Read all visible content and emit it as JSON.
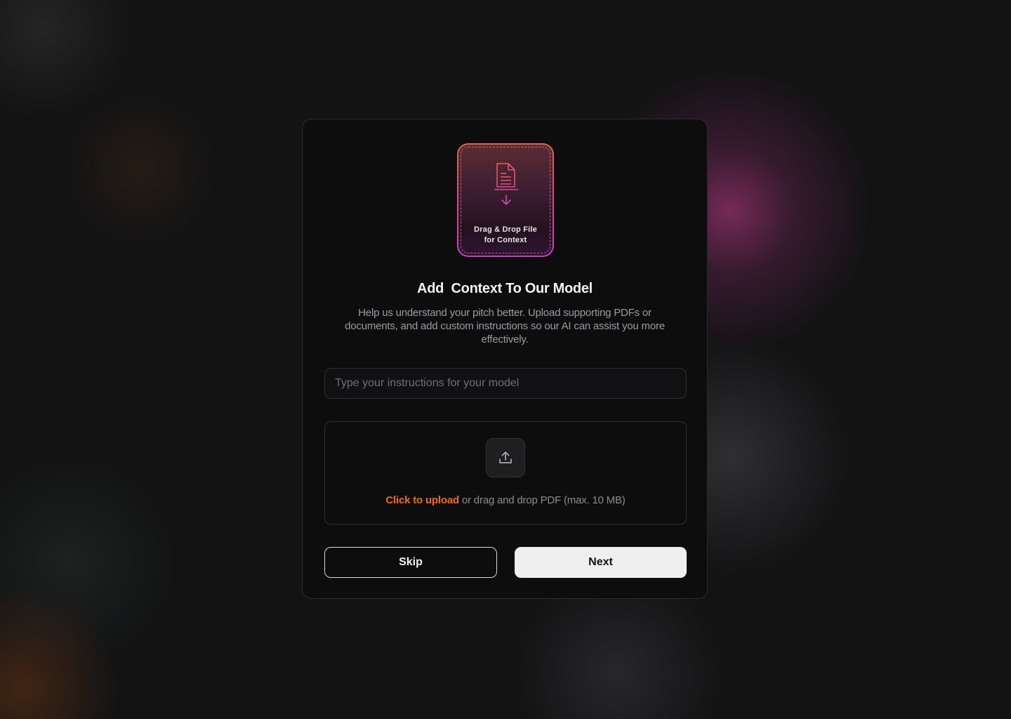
{
  "drop_tile": {
    "line1": "Drag & Drop File",
    "line2": "for Context",
    "icon": "document-download-icon"
  },
  "header": {
    "title": "Add  Context To Our Model",
    "subtitle": "Help us understand your pitch better. Upload supporting PDFs or documents, and add custom instructions so our AI can assist you more effectively."
  },
  "instructions": {
    "value": "",
    "placeholder": "Type your instructions for your model"
  },
  "upload": {
    "icon": "upload-icon",
    "link_label": "Click to upload",
    "hint": " or drag and drop PDF (max. 10 MB)"
  },
  "actions": {
    "skip_label": "Skip",
    "next_label": "Next"
  },
  "colors": {
    "accent_orange": "#f26a16",
    "tile_gradient_start": "#e0663a",
    "tile_gradient_end": "#c23fc6",
    "card_background": "#0d0d0e"
  }
}
